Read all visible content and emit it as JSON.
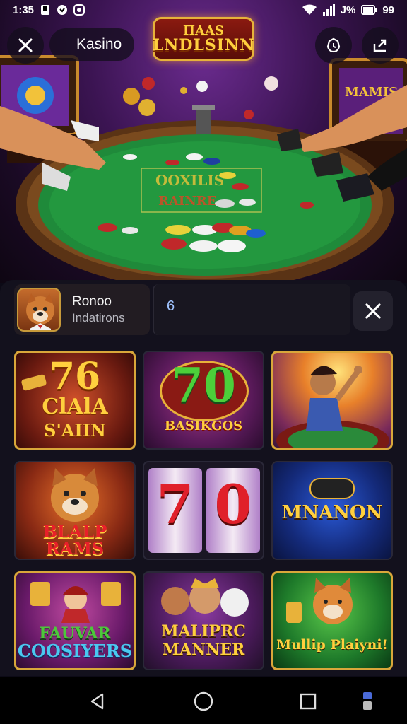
{
  "status_bar": {
    "time": "1:35",
    "battery_text": "J%",
    "battery_level": "99"
  },
  "header": {
    "title": "Kasino",
    "logo_line1": "ΠAAS",
    "logo_line2": "LNDLSINN"
  },
  "profile": {
    "name": "Ronoo",
    "subtitle": "Indatirons",
    "counter": "6"
  },
  "games": [
    {
      "line1": "76",
      "line2": "ClAlA",
      "line3": "S'AIIN"
    },
    {
      "line1": "70",
      "line2": "BASIKGOS"
    },
    {
      "line1": ""
    },
    {
      "line1": "BLALP RAMS"
    },
    {
      "line1": "7",
      "line2": "0"
    },
    {
      "line1": "MNANON"
    },
    {
      "line1": "FAUVAR",
      "line2": "COOSIYERS"
    },
    {
      "line1": "MALIPRC",
      "line2": "MANNER"
    },
    {
      "line1": "Mullip Plaiyni!"
    }
  ],
  "hero_table_text": {
    "line1": "OOXILIS",
    "line2": "RAINRE"
  },
  "colors": {
    "accent_gold": "#d9a73a",
    "felt_green": "#1f8a3a",
    "panel_bg": "#13111d"
  },
  "icons": [
    "close-icon",
    "timer-icon",
    "share-icon",
    "back-icon",
    "home-icon",
    "recents-icon",
    "accessibility-icon"
  ]
}
